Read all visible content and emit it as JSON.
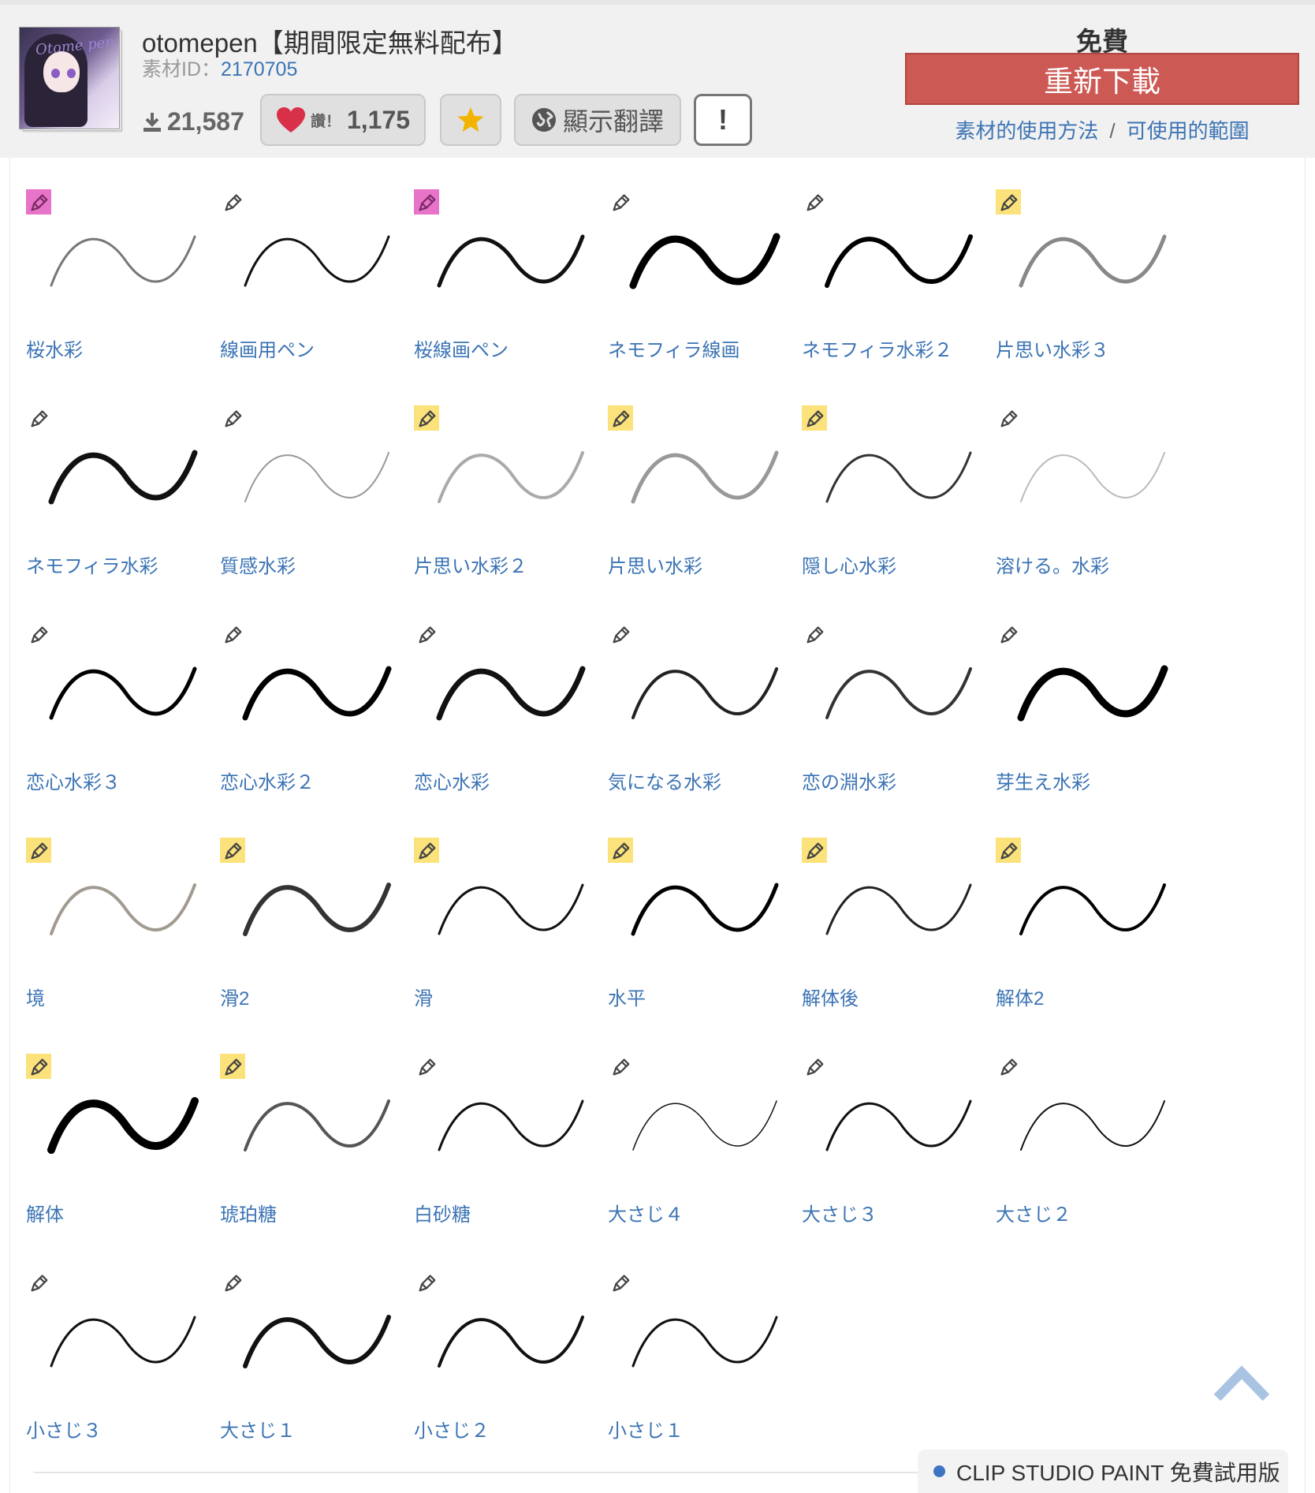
{
  "header": {
    "title": "otomepen【期間限定無料配布】",
    "material_id_label": "素材ID：",
    "material_id": "2170705",
    "downloads": "21,587",
    "like_label": "讚！",
    "likes": "1,175",
    "translate_label": "顯示翻譯",
    "report_label": "!",
    "price": "免費",
    "download_button": "重新下載",
    "link_usage": "素材的使用方法",
    "link_separator": "/",
    "link_scope": "可使用的範圍",
    "thumbnail_text": "Otome pen"
  },
  "brushes": [
    {
      "name": "桜水彩",
      "icon": "pink",
      "weight": 3,
      "tone": "#777"
    },
    {
      "name": "線画用ペン",
      "icon": "plain",
      "weight": 3,
      "tone": "#111"
    },
    {
      "name": "桜線画ペン",
      "icon": "pink",
      "weight": 5,
      "tone": "#111"
    },
    {
      "name": "ネモフィラ線画",
      "icon": "plain",
      "weight": 9,
      "tone": "#000"
    },
    {
      "name": "ネモフィラ水彩２",
      "icon": "plain",
      "weight": 6,
      "tone": "#000"
    },
    {
      "name": "片思い水彩３",
      "icon": "yellow",
      "weight": 5,
      "tone": "#888"
    },
    {
      "name": "ネモフィラ水彩",
      "icon": "plain",
      "weight": 7,
      "tone": "#111"
    },
    {
      "name": "質感水彩",
      "icon": "plain",
      "weight": 2,
      "tone": "#999"
    },
    {
      "name": "片思い水彩２",
      "icon": "yellow",
      "weight": 4,
      "tone": "#aaa"
    },
    {
      "name": "片思い水彩",
      "icon": "yellow",
      "weight": 5,
      "tone": "#999"
    },
    {
      "name": "隠し心水彩",
      "icon": "yellow",
      "weight": 3,
      "tone": "#333"
    },
    {
      "name": "溶ける。水彩",
      "icon": "plain",
      "weight": 2,
      "tone": "#bbb"
    },
    {
      "name": "恋心水彩３",
      "icon": "plain",
      "weight": 5,
      "tone": "#000"
    },
    {
      "name": "恋心水彩２",
      "icon": "plain",
      "weight": 7,
      "tone": "#000"
    },
    {
      "name": "恋心水彩",
      "icon": "plain",
      "weight": 7,
      "tone": "#111"
    },
    {
      "name": "気になる水彩",
      "icon": "plain",
      "weight": 4,
      "tone": "#222"
    },
    {
      "name": "恋の淵水彩",
      "icon": "plain",
      "weight": 4,
      "tone": "#333"
    },
    {
      "name": "芽生え水彩",
      "icon": "plain",
      "weight": 9,
      "tone": "#000"
    },
    {
      "name": "境",
      "icon": "yellow",
      "weight": 4,
      "tone": "#a09a90"
    },
    {
      "name": "滑2",
      "icon": "yellow",
      "weight": 6,
      "tone": "#333"
    },
    {
      "name": "滑",
      "icon": "yellow",
      "weight": 3,
      "tone": "#111"
    },
    {
      "name": "水平",
      "icon": "yellow",
      "weight": 5,
      "tone": "#000"
    },
    {
      "name": "解体後",
      "icon": "yellow",
      "weight": 3,
      "tone": "#222"
    },
    {
      "name": "解体2",
      "icon": "yellow",
      "weight": 4,
      "tone": "#000"
    },
    {
      "name": "解体",
      "icon": "yellow",
      "weight": 10,
      "tone": "#000"
    },
    {
      "name": "琥珀糖",
      "icon": "yellow",
      "weight": 4,
      "tone": "#555"
    },
    {
      "name": "白砂糖",
      "icon": "plain",
      "weight": 3,
      "tone": "#111"
    },
    {
      "name": "大さじ４",
      "icon": "plain",
      "weight": 1.5,
      "tone": "#111"
    },
    {
      "name": "大さじ３",
      "icon": "plain",
      "weight": 3,
      "tone": "#111"
    },
    {
      "name": "大さじ２",
      "icon": "plain",
      "weight": 2,
      "tone": "#111"
    },
    {
      "name": "小さじ３",
      "icon": "plain",
      "weight": 3,
      "tone": "#111"
    },
    {
      "name": "大さじ１",
      "icon": "plain",
      "weight": 6,
      "tone": "#111"
    },
    {
      "name": "小さじ２",
      "icon": "plain",
      "weight": 4,
      "tone": "#111"
    },
    {
      "name": "小さじ１",
      "icon": "plain",
      "weight": 3,
      "tone": "#111"
    }
  ],
  "footer": {
    "trial_label": "CLIP STUDIO PAINT 免費試用版"
  },
  "colors": {
    "link": "#3c74b4",
    "download_button": "#cc5954",
    "like_heart": "#d9304a",
    "favorite_star": "#f2b400",
    "to_top": "#a9c3e3"
  },
  "icons": [
    "download-icon",
    "heart-icon",
    "star-icon",
    "globe-icon",
    "pen-icon",
    "arrow-up-icon"
  ]
}
